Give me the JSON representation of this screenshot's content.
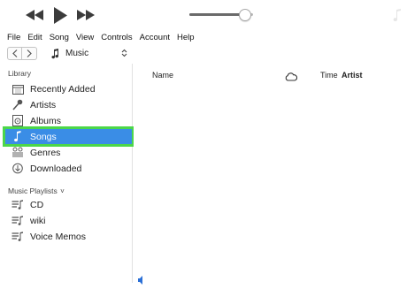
{
  "menubar": [
    "File",
    "Edit",
    "Song",
    "View",
    "Controls",
    "Account",
    "Help"
  ],
  "media_selector": {
    "label": "Music"
  },
  "sidebar": {
    "library_title": "Library",
    "library_items": [
      {
        "label": "Recently Added",
        "icon": "calendar-icon"
      },
      {
        "label": "Artists",
        "icon": "microphone-icon"
      },
      {
        "label": "Albums",
        "icon": "album-icon"
      },
      {
        "label": "Songs",
        "icon": "music-note-icon",
        "selected": true
      },
      {
        "label": "Genres",
        "icon": "genres-icon"
      },
      {
        "label": "Downloaded",
        "icon": "download-icon"
      }
    ],
    "playlists_title": "Music Playlists",
    "playlists_chevron": "˅",
    "playlists": [
      {
        "label": "CD",
        "icon": "playlist-icon"
      },
      {
        "label": "wiki",
        "icon": "playlist-icon"
      },
      {
        "label": "Voice Memos",
        "icon": "playlist-icon"
      }
    ]
  },
  "columns": {
    "name": "Name",
    "time": "Time",
    "artist": "Artist"
  },
  "player": {
    "volume_fraction": 0.88
  },
  "colors": {
    "selection": "#3a8de6",
    "highlight_outline": "#4cd64a"
  }
}
